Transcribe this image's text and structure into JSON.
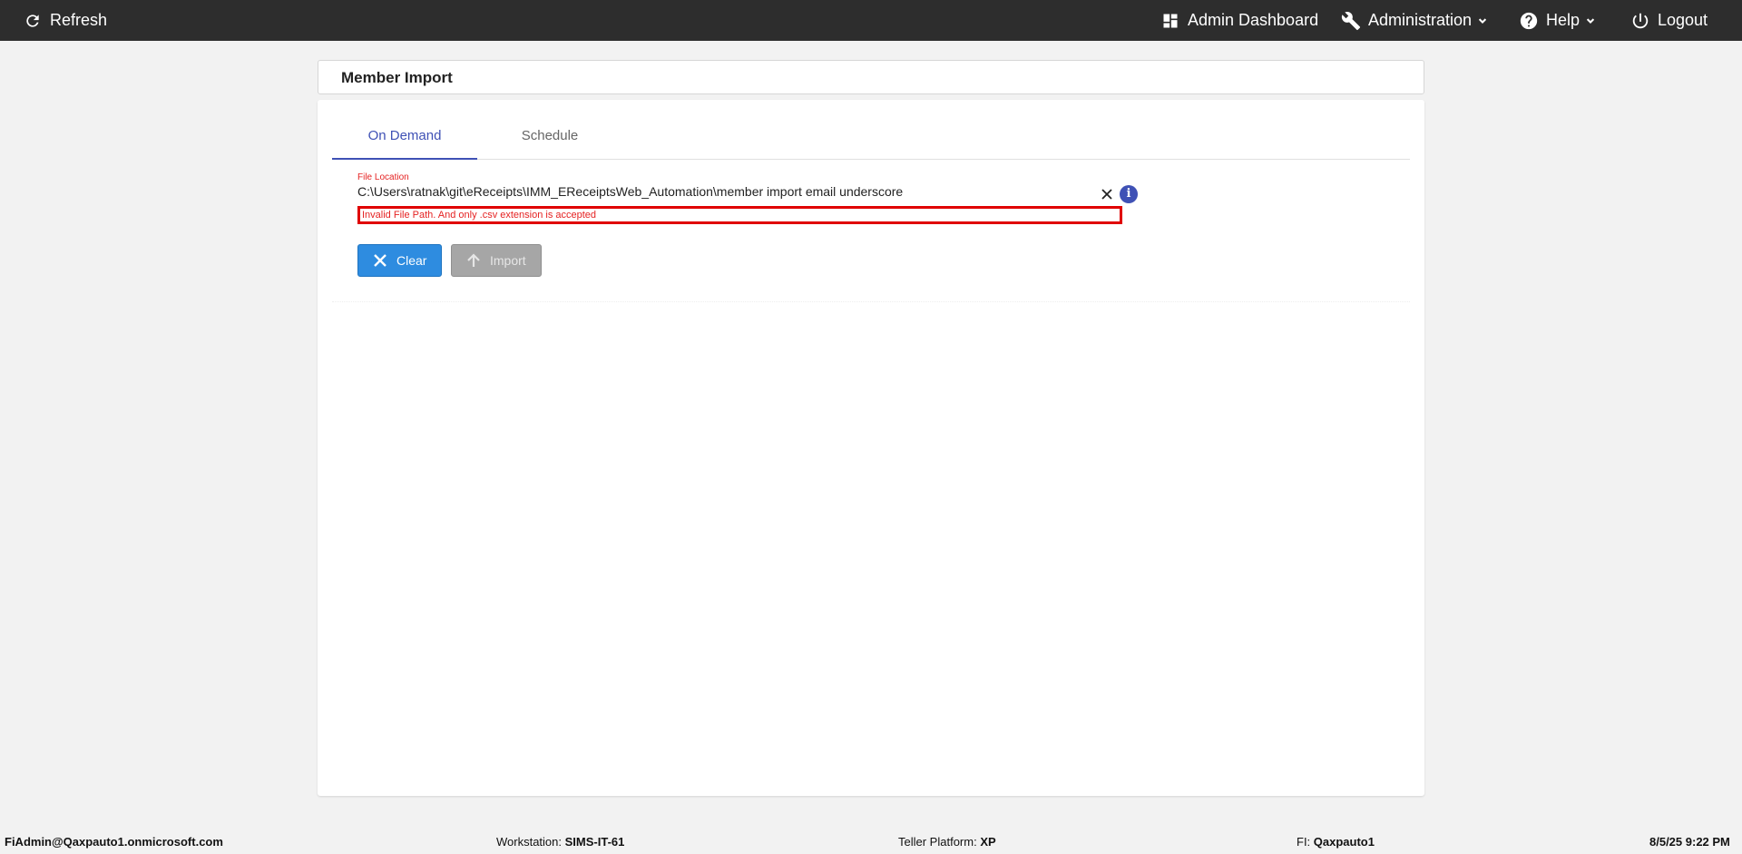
{
  "topbar": {
    "refresh_label": "Refresh",
    "dashboard_label": "Admin Dashboard",
    "administration_label": "Administration",
    "help_label": "Help",
    "logout_label": "Logout"
  },
  "page": {
    "title": "Member Import"
  },
  "tabs": [
    {
      "label": "On Demand",
      "active": true
    },
    {
      "label": "Schedule",
      "active": false
    }
  ],
  "file_location": {
    "label": "File Location",
    "value": "C:\\Users\\ratnak\\git\\eReceipts\\IMM_EReceiptsWeb_Automation\\member import email underscore",
    "error": "Invalid File Path. And only .csv extension is accepted",
    "info_glyph": "i"
  },
  "buttons": {
    "clear_label": "Clear",
    "import_label": "Import"
  },
  "footer": {
    "user": "FiAdmin@Qaxpauto1.onmicrosoft.com",
    "workstation_label": "Workstation:",
    "workstation_value": "SIMS-IT-61",
    "teller_platform_label": "Teller Platform:",
    "teller_platform_value": "XP",
    "fi_label": "FI:",
    "fi_value": "Qaxpauto1",
    "datetime": "8/5/25 9:22 PM"
  },
  "colors": {
    "topbar": "#2d2d2d",
    "accent": "#3f51b5",
    "clear_button": "#2e8ce0",
    "import_button_disabled": "#a6a6a6",
    "error": "#e00000"
  },
  "icons": {
    "refresh": "refresh-icon",
    "dashboard": "dashboard-icon",
    "administration": "wrench-icon",
    "help": "help-circle-icon",
    "logout": "power-icon",
    "clear": "close-icon",
    "import": "arrow-up-icon",
    "info": "info-icon"
  }
}
